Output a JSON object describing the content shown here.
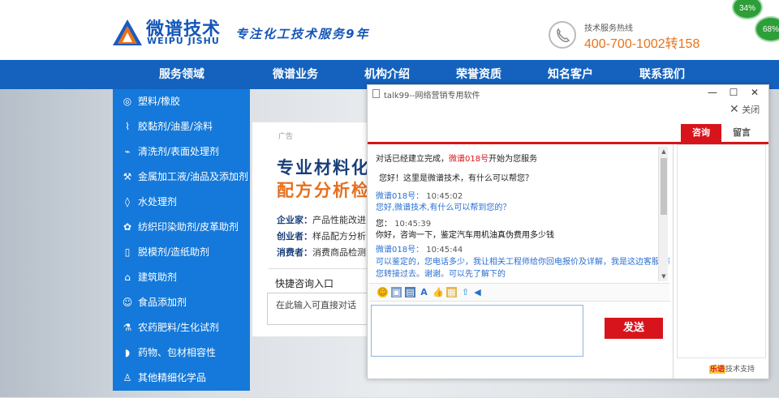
{
  "header": {
    "brand_cn": "微谱技术",
    "brand_en": "WEIPU JISHU",
    "slogan": "专注化工技术服务9年",
    "hotline_label": "技术服务热线",
    "hotline_number": "400-700-1002转158",
    "badge_1": "34%",
    "badge_2": "68%"
  },
  "nav": [
    "服务领域",
    "微谱业务",
    "机构介绍",
    "荣誉资质",
    "知名客户",
    "联系我们"
  ],
  "sidebar": {
    "items": [
      {
        "icon": "◎",
        "label": "塑料/橡胶"
      },
      {
        "icon": "⌇",
        "label": "胶黏剂/油墨/涂料"
      },
      {
        "icon": "⌁",
        "label": "清洗剂/表面处理剂"
      },
      {
        "icon": "⚒",
        "label": "金属加工液/油品及添加剂"
      },
      {
        "icon": "◊",
        "label": "水处理剂"
      },
      {
        "icon": "✿",
        "label": "纺织印染助剂/皮革助剂"
      },
      {
        "icon": "▯",
        "label": "脱模剂/造纸助剂"
      },
      {
        "icon": "⌂",
        "label": "建筑助剂"
      },
      {
        "icon": "☺",
        "label": "食品添加剂"
      },
      {
        "icon": "⚗",
        "label": "农药肥料/生化试剂"
      },
      {
        "icon": "◗",
        "label": "药物、包材相容性"
      },
      {
        "icon": "♙",
        "label": "其他精细化学品"
      }
    ]
  },
  "ad": {
    "tag": "广告",
    "headline_1": "专业材料化",
    "headline_2": "配方分析检",
    "lines": [
      {
        "role": "企业家：",
        "text": "产品性能改进"
      },
      {
        "role": "创业者：",
        "text": "样品配方分析"
      },
      {
        "role": "消费者：",
        "text": "消费商品检测"
      }
    ],
    "quick_title": "快捷咨询入口",
    "quick_placeholder": "在此输入可直接对话"
  },
  "chat": {
    "title": "talk99--网络营销专用软件",
    "close_label": "关闭",
    "tabs": [
      "咨询",
      "留言"
    ],
    "system_prefix": "对话已经建立完成，",
    "system_agent": "微谱018号",
    "system_suffix": "开始为您服务",
    "greeting": "您好！这里是微谱技术，有什么可以帮您？",
    "messages": [
      {
        "sender": "微谱018号：",
        "time": "10:45:02",
        "text": "您好,微谱技术,有什么可以帮到您的？",
        "type": "agent"
      },
      {
        "sender": "您：",
        "time": "10:45:39",
        "text": "你好，咨询一下，鉴定汽车用机油真伪费用多少钱",
        "type": "user"
      },
      {
        "sender": "微谱018号：",
        "time": "10:45:44",
        "text": "可以鉴定的，您电话多少，我让相关工程师给你回电报价及详解，我是这边客服，帮",
        "text2": "您转接过去。谢谢。可以先了解下的",
        "type": "agent"
      }
    ],
    "input_value": "",
    "send_label": "发送",
    "powered_brand": "乐语",
    "powered_text": "技术支持"
  }
}
